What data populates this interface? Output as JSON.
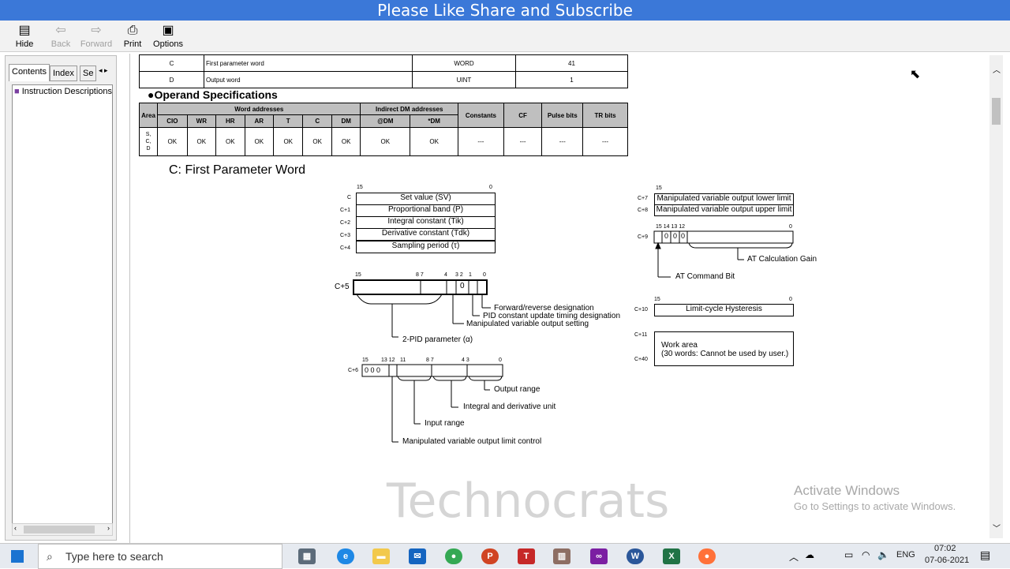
{
  "banner": "Please Like Share and Subscribe",
  "toolbar": {
    "hide": "Hide",
    "back": "Back",
    "forward": "Forward",
    "print": "Print",
    "options": "Options"
  },
  "tabs": {
    "contents": "Contents",
    "index": "Index",
    "search": "Se"
  },
  "tree": {
    "item": "Instruction Descriptions"
  },
  "operand_rows": [
    {
      "key": "C",
      "desc": "First  parameter  word",
      "type": "WORD",
      "size": "41"
    },
    {
      "key": "D",
      "desc": "Output  word",
      "type": "UINT",
      "size": "1"
    }
  ],
  "specs": {
    "heading": "●Operand  Specifications",
    "area": "Area",
    "word_addresses": "Word  addresses",
    "indirect": "Indirect  DM  addresses",
    "constants": "Constants",
    "cf": "CF",
    "pulse": "Pulse  bits",
    "tr": "TR  bits",
    "cols": [
      "CIO",
      "WR",
      "HR",
      "AR",
      "T",
      "C",
      "DM",
      "@DM",
      "*DM"
    ],
    "area_val": "S,\nC,\nD",
    "vals": [
      "OK",
      "OK",
      "OK",
      "OK",
      "OK",
      "OK",
      "OK",
      "OK",
      "OK",
      "---",
      "---",
      "---",
      "---"
    ]
  },
  "section_title": "C:  First  Parameter  Word",
  "words": {
    "bit15": "15",
    "bit0": "0",
    "c": [
      "C",
      "C+1",
      "C+2",
      "C+3",
      "C+4"
    ],
    "c_labels": [
      "Set value (SV)",
      "Proportional band (P)",
      "Integral constant (Tik)",
      "Derivative constant (Tdk)",
      "Sampling period (τ)"
    ],
    "c5": "C+5",
    "c5_bits": [
      "15",
      "8  7",
      "4",
      "3 2",
      "1",
      "0"
    ],
    "c5_zero": "0",
    "c5_labels": [
      "Forward/reverse designation",
      "PID constant update timing designation",
      "Manipulated variable output setting",
      "2-PID parameter (α)"
    ],
    "c6": "C+6",
    "c6_bits": [
      "15",
      "13 12",
      "11",
      "8  7",
      "4  3",
      "0"
    ],
    "c6_zeros": "0  0  0",
    "c6_labels": [
      "Output range",
      "Integral and derivative unit",
      "Input range",
      "Manipulated variable output limit control"
    ],
    "c7": "C+7",
    "c8": "C+8",
    "c7_label": "Manipulated variable output lower limit",
    "c8_label": "Manipulated variable output upper limit",
    "c9": "C+9",
    "c9_bits": "15 14  13 12",
    "c9_zeros": [
      "0",
      "0",
      "0"
    ],
    "c9_labels": [
      "AT Calculation Gain",
      "AT Command Bit"
    ],
    "c10": "C+10",
    "c10_label": "Limit-cycle Hysteresis",
    "c11": "C+11",
    "c40": "C+40",
    "work_area": "Work area",
    "work_note": "(30 words: Cannot be used by user.)"
  },
  "watermark": "Technocrats",
  "activate": {
    "line1": "Activate Windows",
    "line2": "Go to Settings to activate Windows."
  },
  "taskbar": {
    "search_placeholder": "Type here to search",
    "lang": "ENG",
    "time": "07:02",
    "date": "07-06-2021"
  }
}
